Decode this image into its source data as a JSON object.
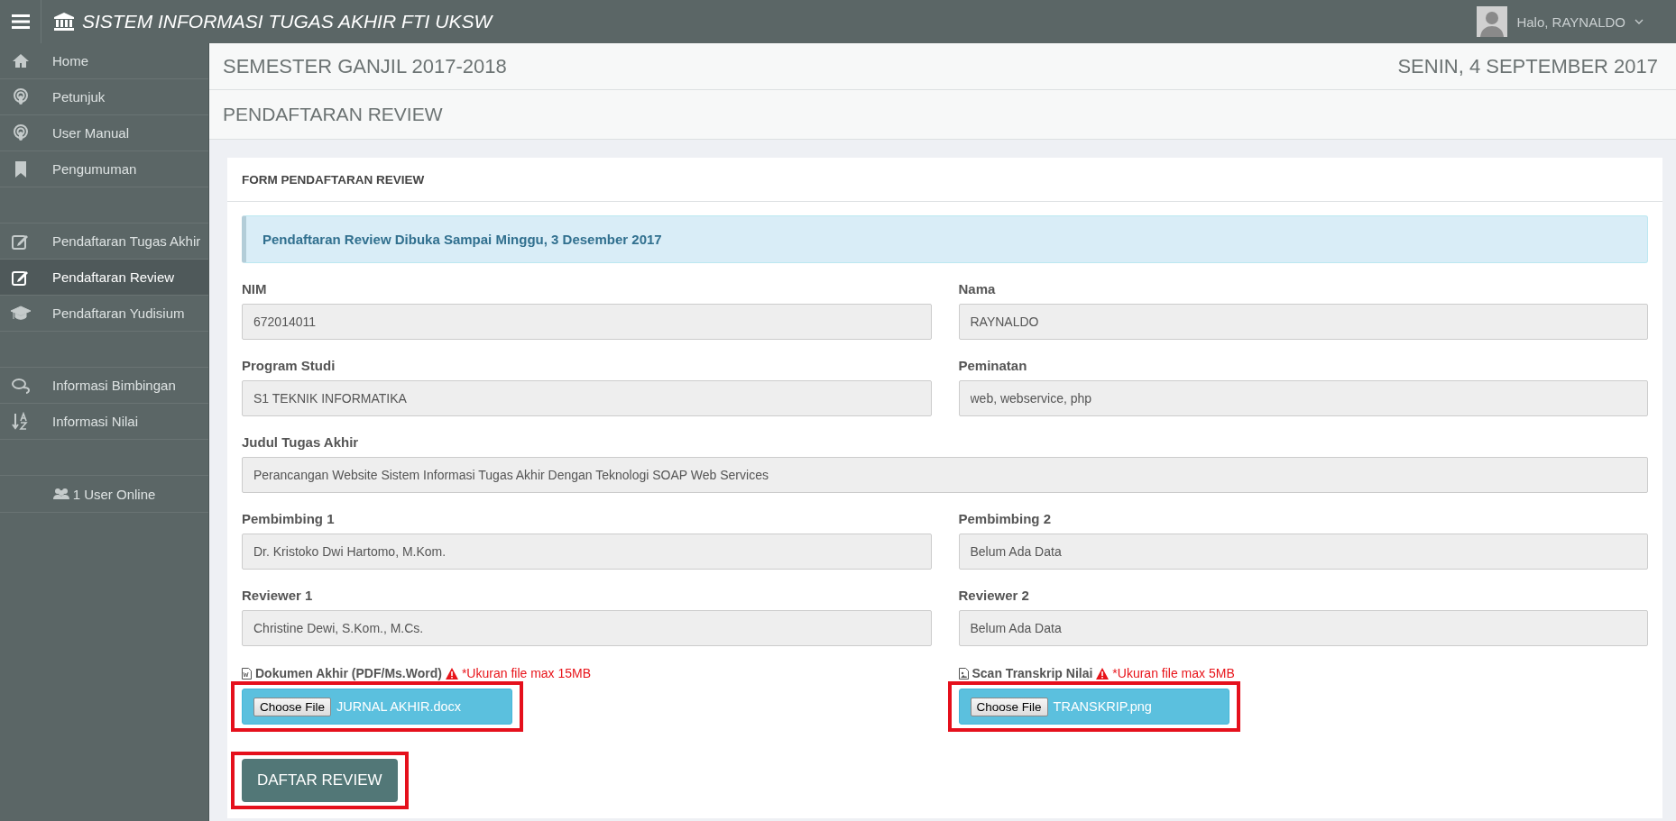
{
  "header": {
    "title": "SISTEM INFORMASI TUGAS AKHIR FTI UKSW",
    "user_greeting": "Halo, RAYNALDO"
  },
  "sidebar": {
    "sections": [
      {
        "items": [
          {
            "label": "Home",
            "selected": false
          },
          {
            "label": "Petunjuk",
            "selected": false
          },
          {
            "label": "User Manual",
            "selected": false
          },
          {
            "label": "Pengumuman",
            "selected": false
          }
        ]
      },
      {
        "items": [
          {
            "label": "Pendaftaran Tugas Akhir",
            "selected": false
          },
          {
            "label": "Pendaftaran Review",
            "selected": true
          },
          {
            "label": "Pendaftaran Yudisium",
            "selected": false
          }
        ]
      },
      {
        "items": [
          {
            "label": "Informasi Bimbingan",
            "selected": false
          },
          {
            "label": "Informasi Nilai",
            "selected": false
          }
        ]
      }
    ],
    "online": "1 User Online"
  },
  "semester": "SEMESTER GANJIL 2017-2018",
  "date": "SENIN, 4 SEPTEMBER 2017",
  "page_title": "PENDAFTARAN REVIEW",
  "form": {
    "title": "FORM PENDAFTARAN REVIEW",
    "notice": "Pendaftaran Review Dibuka Sampai Minggu, 3 Desember 2017",
    "rows": [
      [
        {
          "label": "NIM",
          "value": "672014011",
          "readonly": true
        },
        {
          "label": "Nama",
          "value": "RAYNALDO",
          "readonly": true
        }
      ],
      [
        {
          "label": "Program Studi",
          "value": "S1 TEKNIK INFORMATIKA",
          "readonly": true
        },
        {
          "label": "Peminatan",
          "value": "web, webservice, php",
          "readonly": true
        }
      ],
      [
        {
          "label": "Judul Tugas Akhir",
          "value": "Perancangan Website Sistem Informasi Tugas Akhir Dengan Teknologi SOAP Web Services",
          "readonly": true
        }
      ],
      [
        {
          "label": "Pembimbing 1",
          "value": "Dr. Kristoko Dwi Hartomo, M.Kom.",
          "readonly": true
        },
        {
          "label": "Pembimbing 2",
          "value": "Belum Ada Data",
          "readonly": true
        }
      ],
      [
        {
          "label": "Reviewer 1",
          "value": "Christine Dewi, S.Kom., M.Cs.",
          "readonly": true
        },
        {
          "label": "Reviewer 2",
          "value": "Belum Ada Data",
          "readonly": true
        }
      ]
    ],
    "uploads": [
      {
        "kind": "word",
        "label": "Dokumen Akhir (PDF/Ms.Word)",
        "warning": "*Ukuran file max 15MB",
        "button": "Choose File",
        "file_name": "JURNAL AKHIR.docx",
        "highlighted": true
      },
      {
        "kind": "image",
        "label": "Scan Transkrip Nilai",
        "warning": "*Ukuran file max 5MB",
        "button": "Choose File",
        "file_name": "TRANSKRIP.png",
        "highlighted": true
      }
    ],
    "submit": {
      "label": "DAFTAR REVIEW",
      "highlighted": true
    }
  }
}
